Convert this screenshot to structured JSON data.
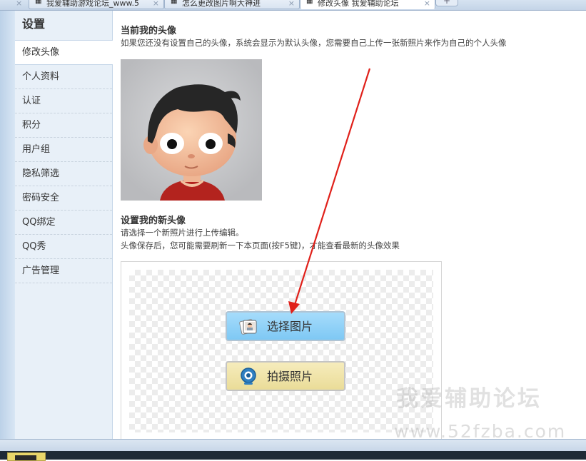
{
  "browser": {
    "tabs": [
      {
        "label": "我爱辅助游戏论坛_www.5"
      },
      {
        "label": "怎么更改图片啊大神进"
      },
      {
        "label": "修改头像 我爱辅助论坛"
      }
    ],
    "new_tab": "+",
    "close_glyph": "×"
  },
  "sidebar": {
    "title": "设置",
    "items": [
      {
        "label": "修改头像"
      },
      {
        "label": "个人资料"
      },
      {
        "label": "认证"
      },
      {
        "label": "积分"
      },
      {
        "label": "用户组"
      },
      {
        "label": "隐私筛选"
      },
      {
        "label": "密码安全"
      },
      {
        "label": "QQ绑定"
      },
      {
        "label": "QQ秀"
      },
      {
        "label": "广告管理"
      }
    ]
  },
  "current_avatar": {
    "title": "当前我的头像",
    "desc": "如果您还没有设置自己的头像，系统会显示为默认头像，您需要自己上传一张新照片来作为自己的个人头像"
  },
  "new_avatar": {
    "title": "设置我的新头像",
    "desc1": "请选择一个新照片进行上传编辑。",
    "desc2": "头像保存后，您可能需要刷新一下本页面(按F5键)，才能查看最新的头像效果"
  },
  "uploader": {
    "select_label": "选择图片",
    "camera_label": "拍摄照片"
  },
  "watermark": {
    "cn": "我爱辅助论坛",
    "url": "www.52fzba.com"
  },
  "colors": {
    "select_button": "#8fd1f7",
    "camera_button": "#efe3a8",
    "annotation_arrow": "#e0201a"
  }
}
